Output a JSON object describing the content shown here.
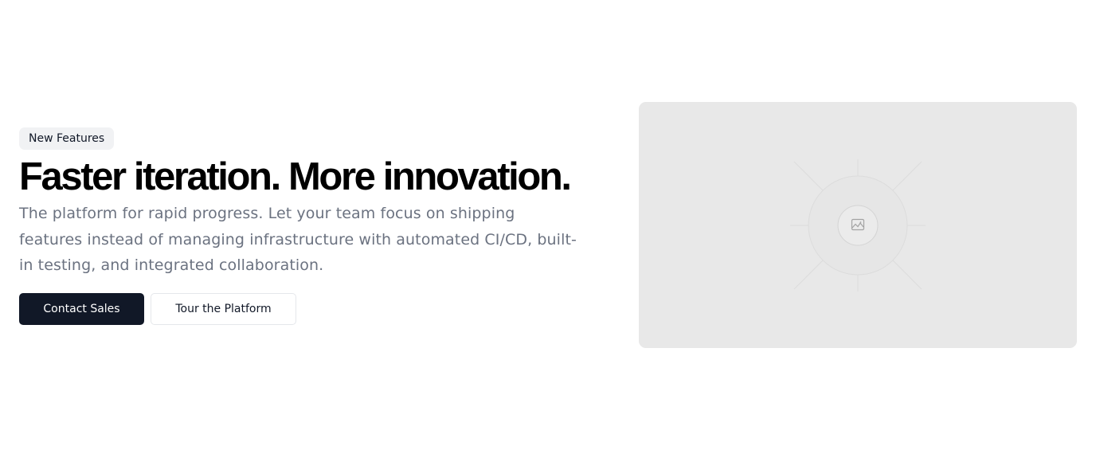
{
  "hero": {
    "badge": "New Features",
    "title": "Faster iteration. More innovation.",
    "subtitle": "The platform for rapid progress. Let your team focus on shipping features instead of managing infrastructure with automated CI/CD, built-in testing, and integrated collaboration.",
    "primary_button": "Contact Sales",
    "secondary_button": "Tour the Platform"
  },
  "media": {
    "icon": "image-placeholder-icon"
  },
  "colors": {
    "primary_button_bg": "#111827",
    "badge_bg": "#f1f2f4",
    "muted_text": "#6b7280",
    "placeholder_bg": "#e8e8e8"
  }
}
